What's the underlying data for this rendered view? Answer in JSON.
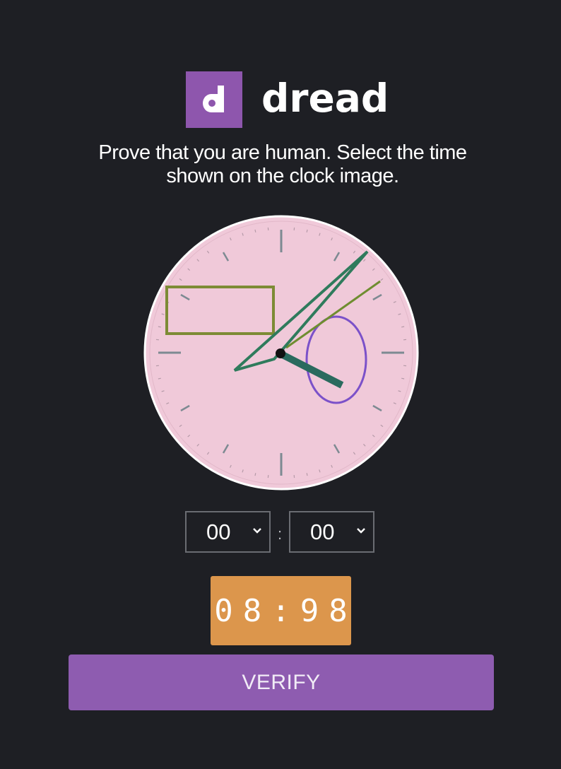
{
  "brand": {
    "name": "dread",
    "logo_letter": "d",
    "accent_color": "#8e56ad"
  },
  "captcha": {
    "instructions": "Prove that you are human. Select the time shown on the clock image.",
    "clock_face_color": "#f0c9d9",
    "hour_select": {
      "value": "00"
    },
    "minute_select": {
      "value": "00"
    },
    "separator": ":",
    "timer": "08:98",
    "timer_color": "#dc964c"
  },
  "verify_button": {
    "label": "VERIFY",
    "color": "#8e5cb0"
  }
}
